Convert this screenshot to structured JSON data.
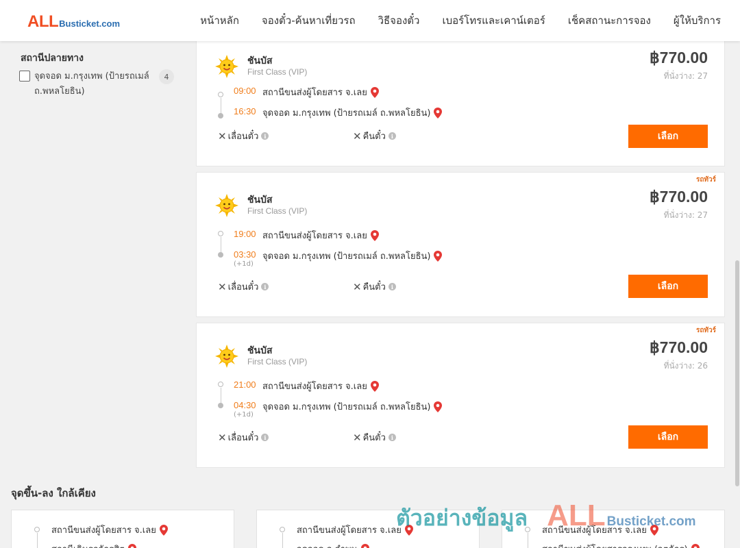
{
  "header": {
    "logo_all": "ALL",
    "logo_rest": "Busticket.com",
    "nav": [
      "หน้าหลัก",
      "จองตั๋ว-ค้นหาเที่ยวรถ",
      "วิธีจองตั๋ว",
      "เบอร์โทรและเคาน์เตอร์",
      "เช็คสถานะการจอง",
      "ผู้ให้บริการ"
    ]
  },
  "filter": {
    "title": "สถานีปลายทาง",
    "option_label": "จุดจอด ม.กรุงเทพ (ป้ายรถเมล์ ถ.พหลโยธิน)",
    "option_count": "4",
    "checked": false
  },
  "trips": [
    {
      "operator": "ชันบัส",
      "class": "First Class (VIP)",
      "price": "฿770.00",
      "seats": "ที่นั่งว่าง: 27",
      "depart_time": "09:00",
      "depart_stop": "สถานีขนส่งผู้โดยสาร จ.เลย",
      "arrive_time": "16:30",
      "arrive_stop": "จุดจอด ม.กรุงเทพ (ป้ายรถเมล์ ถ.พหลโยธิน)",
      "change": "เลื่อนตั๋ว",
      "refund": "คืนตั๋ว",
      "select": "เลือก"
    },
    {
      "ribbon": "รถทัวร์",
      "operator": "ชันบัส",
      "class": "First Class (VIP)",
      "price": "฿770.00",
      "seats": "ที่นั่งว่าง: 27",
      "depart_time": "19:00",
      "depart_stop": "สถานีขนส่งผู้โดยสาร จ.เลย",
      "arrive_time": "03:30",
      "arrive_stop": "จุดจอด ม.กรุงเทพ (ป้ายรถเมล์ ถ.พหลโยธิน)",
      "next_day": "(+1d)",
      "change": "เลื่อนตั๋ว",
      "refund": "คืนตั๋ว",
      "select": "เลือก"
    },
    {
      "ribbon": "รถทัวร์",
      "operator": "ชันบัส",
      "class": "First Class (VIP)",
      "price": "฿770.00",
      "seats": "ที่นั่งว่าง: 26",
      "depart_time": "21:00",
      "depart_stop": "สถานีขนส่งผู้โดยสาร จ.เลย",
      "arrive_time": "04:30",
      "arrive_stop": "จุดจอด ม.กรุงเทพ (ป้ายรถเมล์ ถ.พหลโยธิน)",
      "next_day": "(+1d)",
      "change": "เลื่อนตั๋ว",
      "refund": "คืนตั๋ว",
      "select": "เลือก"
    }
  ],
  "nearby": {
    "title": "จุดขึ้น-ลง ใกล้เคียง",
    "cards": [
      {
        "from": "สถานีขนส่งผู้โดยสาร จ.เลย",
        "to": "สถานีเดินรถจักรสิต"
      },
      {
        "from": "สถานีขนส่งผู้โดยสาร จ.เลย",
        "to": "จุดจอด จ.ลำพูน"
      },
      {
        "from": "สถานีขนส่งผู้โดยสาร จ.เลย",
        "to": "สถานีขนส่งผู้โดยสารกรุงเทพ (จตุจักร)"
      }
    ]
  },
  "watermark": {
    "text": "ตัวอย่างข้อมูล",
    "all": "ALL",
    "rest": "Busticket.com"
  },
  "colors": {
    "accent": "#ff6b00",
    "time": "#f07d1b",
    "pin": "#e53935",
    "logo_all": "#f04e23",
    "logo_rest": "#2a6db0"
  },
  "icons": {
    "operator_logo": "smiling-sun-icon",
    "location": "map-pin-icon",
    "cross": "x-icon",
    "info": "info-icon"
  }
}
